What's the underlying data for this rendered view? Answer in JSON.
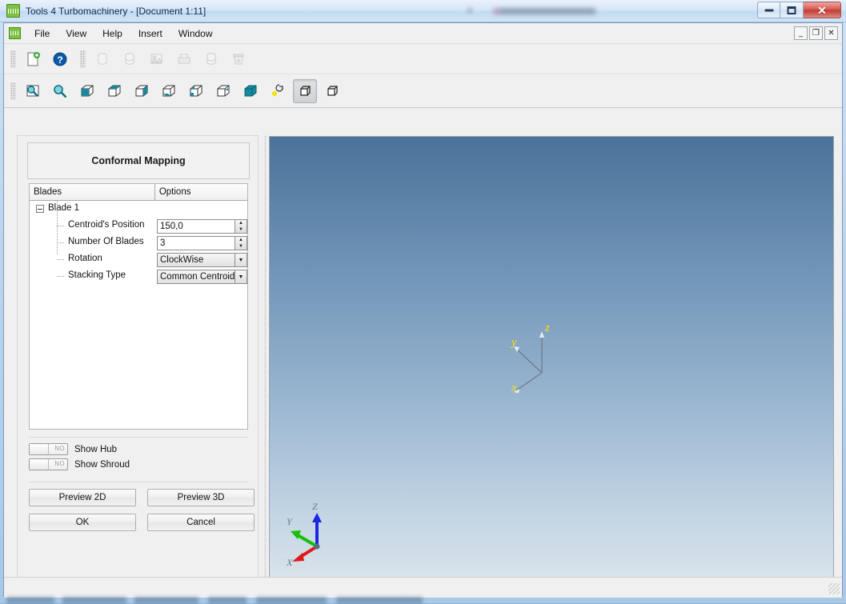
{
  "window": {
    "title": "Tools 4 Turbomachinery - [Document 1:11]",
    "app_icon": "app-logo-icon",
    "controls": {
      "minimize": "–",
      "maximize": "□",
      "close": "✕"
    }
  },
  "menubar": {
    "items": [
      {
        "label": "File"
      },
      {
        "label": "View"
      },
      {
        "label": "Help"
      },
      {
        "label": "Insert"
      },
      {
        "label": "Window"
      }
    ],
    "mdi_controls": {
      "minimize": "_",
      "restore": "❐",
      "close": "✕"
    }
  },
  "toolbar_file": {
    "buttons": [
      {
        "name": "new-document-icon",
        "enabled": true
      },
      {
        "name": "help-icon",
        "enabled": true
      },
      {
        "name": "save-icon",
        "enabled": false
      },
      {
        "name": "database-icon",
        "enabled": false
      },
      {
        "name": "export-image-icon",
        "enabled": false
      },
      {
        "name": "print-icon",
        "enabled": false
      },
      {
        "name": "database-copy-icon",
        "enabled": false
      },
      {
        "name": "delete-database-icon",
        "enabled": false
      }
    ]
  },
  "toolbar_view": {
    "buttons": [
      {
        "name": "zoom-window-icon",
        "enabled": true,
        "pressed": false
      },
      {
        "name": "zoom-fit-icon",
        "enabled": true,
        "pressed": false
      },
      {
        "name": "view-front-icon",
        "enabled": true,
        "pressed": false
      },
      {
        "name": "view-top-icon",
        "enabled": true,
        "pressed": false
      },
      {
        "name": "view-right-icon",
        "enabled": true,
        "pressed": false
      },
      {
        "name": "view-bottom-icon",
        "enabled": true,
        "pressed": false
      },
      {
        "name": "view-left-icon",
        "enabled": true,
        "pressed": false
      },
      {
        "name": "view-back-icon",
        "enabled": true,
        "pressed": false
      },
      {
        "name": "view-iso-icon",
        "enabled": true,
        "pressed": false
      },
      {
        "name": "rotate-light-icon",
        "enabled": true,
        "pressed": false
      },
      {
        "name": "shaded-view-icon",
        "enabled": true,
        "pressed": true
      },
      {
        "name": "wireframe-view-icon",
        "enabled": true,
        "pressed": false
      }
    ]
  },
  "panel": {
    "header": "Conformal Mapping",
    "tree": {
      "columns": [
        "Blades",
        "Options"
      ],
      "root": {
        "label": "Blade 1",
        "expanded": true
      },
      "rows": [
        {
          "label": "Centroid's Position",
          "editor": "spinbox",
          "value": "150,0"
        },
        {
          "label": "Number Of Blades",
          "editor": "spinbox",
          "value": "3"
        },
        {
          "label": "Rotation",
          "editor": "combobox",
          "value": "ClockWise"
        },
        {
          "label": "Stacking Type",
          "editor": "combobox",
          "value": "Common Centroid"
        }
      ]
    },
    "toggles": [
      {
        "label": "Show Hub",
        "state": "NO"
      },
      {
        "label": "Show Shroud",
        "state": "NO"
      }
    ],
    "buttons": {
      "preview_2d": "Preview 2D",
      "preview_3d": "Preview 3D",
      "ok": "OK",
      "cancel": "Cancel"
    }
  },
  "viewport": {
    "axis_center": {
      "x": "x",
      "y": "y",
      "z": "z",
      "color": "#ffe000"
    },
    "axis_corner": {
      "x": "X",
      "y": "Y",
      "z": "Z",
      "x_color": "#e01a1a",
      "y_color": "#12c20a",
      "z_color": "#1a28e0"
    },
    "background_top": "#4b7299",
    "background_bottom": "#dfe6ec"
  },
  "statusbar": {
    "text": ""
  }
}
